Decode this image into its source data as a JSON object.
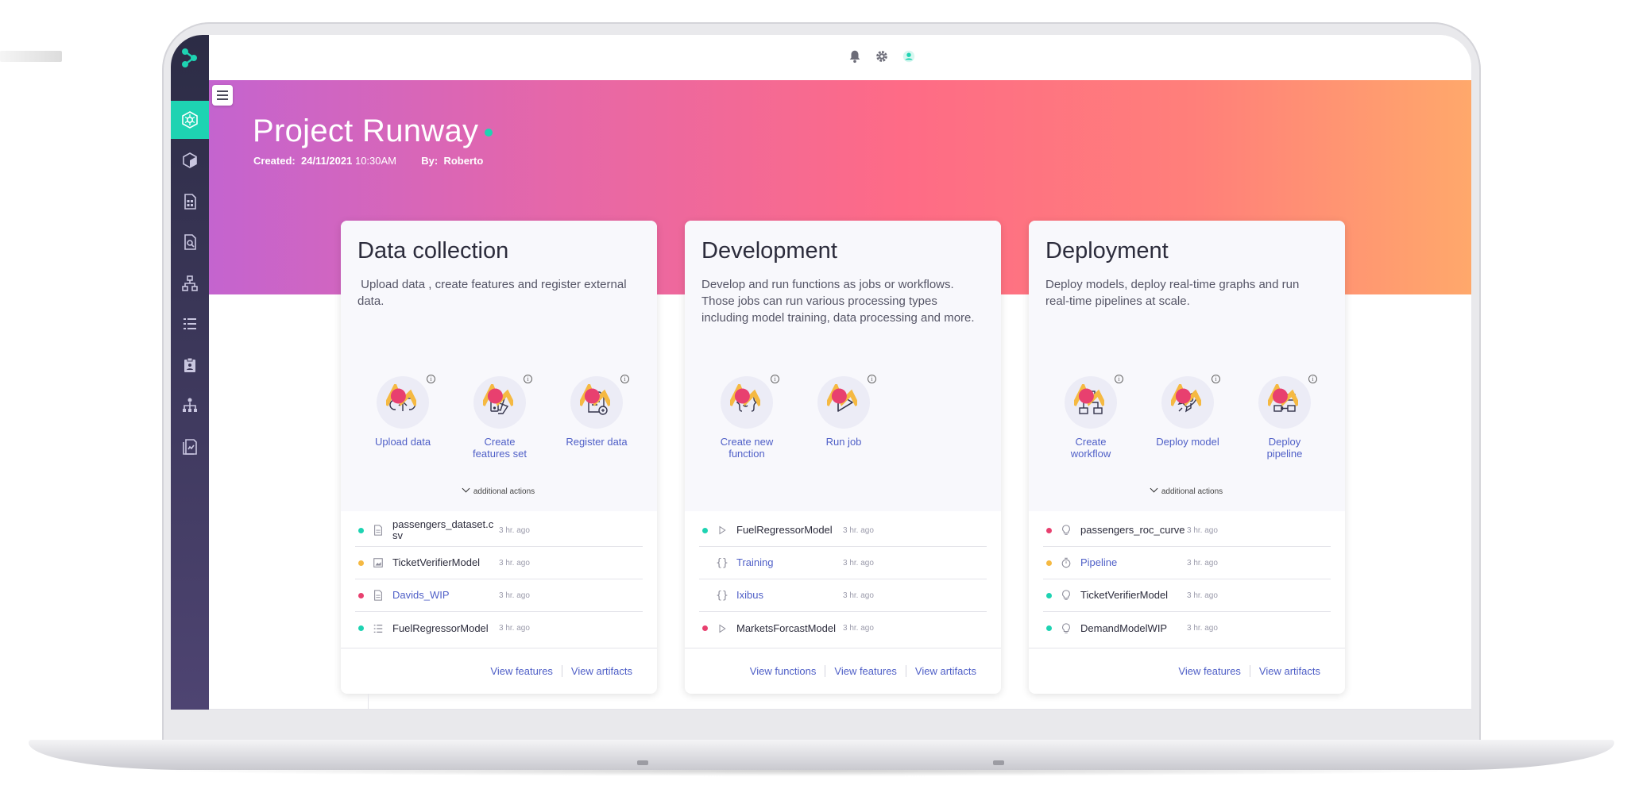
{
  "topbar": {
    "icons": [
      "bell-icon",
      "gear-icon",
      "user-icon"
    ]
  },
  "sidebar": {
    "items": [
      "projects-icon",
      "cube-icon",
      "feature-store-icon",
      "datasets-icon",
      "workflow-icon",
      "list-icon",
      "clipboard-icon",
      "pipeline-icon",
      "monitor-icon"
    ],
    "active_index": 0,
    "accent": "#1ed3b2"
  },
  "project": {
    "title": "Project Runway",
    "created_label": "Created:",
    "created_date": "24/11/2021",
    "created_time": "10:30AM",
    "by_label": "By:",
    "by_name": "Roberto"
  },
  "colors": {
    "link": "#4f5fc7",
    "green": "#1ed3b2",
    "yellow": "#f5b942",
    "pink": "#e8406f",
    "gradient": [
      "#c464cf",
      "#fe6b86",
      "#ffa86b"
    ]
  },
  "cards": [
    {
      "title": "Data collection",
      "description": " Upload data , create features and register external data.",
      "actions": [
        {
          "label": "Upload data",
          "icon": "cloud-upload-icon"
        },
        {
          "label": "Create features set",
          "icon": "feature-set-icon"
        },
        {
          "label": "Register data",
          "icon": "register-data-icon"
        }
      ],
      "more_label": "additional actions",
      "items": [
        {
          "name": "passengers_dataset.csv",
          "time": "3 hr. ago",
          "status": "green",
          "icon": "file-icon",
          "link": false
        },
        {
          "name": "TicketVerifierModel",
          "time": "3 hr. ago",
          "status": "yellow",
          "icon": "image-icon",
          "link": false
        },
        {
          "name": "Davids_WIP",
          "time": "3 hr. ago",
          "status": "pink",
          "icon": "file-icon",
          "link": true
        },
        {
          "name": "FuelRegressorModel",
          "time": "3 hr. ago",
          "status": "green",
          "icon": "list-icon",
          "link": false
        }
      ],
      "footer": [
        "View features",
        "View artifacts"
      ]
    },
    {
      "title": "Development",
      "description": "Develop and run functions as jobs or workflows. Those jobs can run various processing types including model training, data processing and more.",
      "actions": [
        {
          "label": "Create new function",
          "icon": "function-icon"
        },
        {
          "label": "Run job",
          "icon": "play-icon"
        }
      ],
      "more_label": "",
      "items": [
        {
          "name": "FuelRegressorModel",
          "time": "3 hr. ago",
          "status": "green",
          "icon": "play-icon",
          "link": false
        },
        {
          "name": "Training",
          "time": "3 hr. ago",
          "status": "none",
          "icon": "braces-icon",
          "link": true
        },
        {
          "name": "Ixibus",
          "time": "3 hr. ago",
          "status": "none",
          "icon": "braces-icon",
          "link": true
        },
        {
          "name": "MarketsForcastModel",
          "time": "3 hr. ago",
          "status": "pink",
          "icon": "play-icon",
          "link": false
        }
      ],
      "footer": [
        "View functions",
        "View features",
        "View artifacts"
      ]
    },
    {
      "title": "Deployment",
      "description": "Deploy models, deploy real-time graphs and run real-time pipelines at scale.",
      "actions": [
        {
          "label": "Create workflow",
          "icon": "workflow-icon"
        },
        {
          "label": "Deploy model",
          "icon": "rocket-icon"
        },
        {
          "label": "Deploy pipeline",
          "icon": "pipeline-icon"
        }
      ],
      "more_label": "additional actions",
      "items": [
        {
          "name": "passengers_roc_curve",
          "time": "3 hr. ago",
          "status": "pink",
          "icon": "bulb-icon",
          "link": false
        },
        {
          "name": "Pipeline",
          "time": "3 hr. ago",
          "status": "yellow",
          "icon": "timer-icon",
          "link": true
        },
        {
          "name": "TicketVerifierModel",
          "time": "3 hr. ago",
          "status": "green",
          "icon": "bulb-icon",
          "link": false
        },
        {
          "name": "DemandModelWIP",
          "time": "3 hr. ago",
          "status": "green",
          "icon": "bulb-icon",
          "link": false
        }
      ],
      "footer": [
        "View features",
        "View artifacts"
      ]
    }
  ]
}
